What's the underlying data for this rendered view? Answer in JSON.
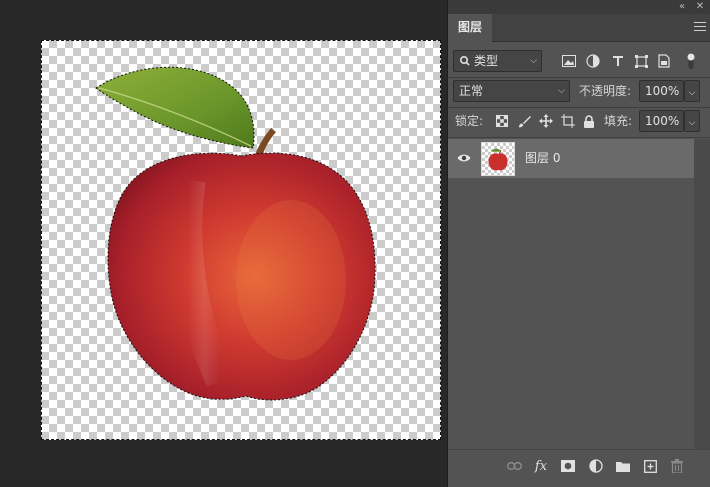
{
  "panel": {
    "tab_label": "图层",
    "filter": {
      "kind_label": "类型"
    },
    "blend_mode": "正常",
    "opacity_label": "不透明度:",
    "opacity_value": "100%",
    "lock_label": "锁定:",
    "fill_label": "填充:",
    "fill_value": "100%",
    "layers": [
      {
        "name": "图层 0",
        "visible": true,
        "selected": true
      }
    ],
    "filter_icons": [
      "image-icon",
      "adjustment-icon",
      "type-icon",
      "shape-icon",
      "smartobject-icon"
    ],
    "lock_icons": [
      "lock-transparent-icon",
      "lock-image-icon",
      "lock-position-icon",
      "lock-artboard-icon",
      "lock-all-icon"
    ],
    "bottom_icons": [
      "link-icon",
      "fx-icon",
      "mask-icon",
      "adjustment-layer-icon",
      "group-icon",
      "new-layer-icon",
      "trash-icon"
    ],
    "fx_label": "fx"
  },
  "colors": {
    "panel_bg": "#535353",
    "selected_row": "#6a6a6a",
    "workspace_bg": "#282828"
  }
}
